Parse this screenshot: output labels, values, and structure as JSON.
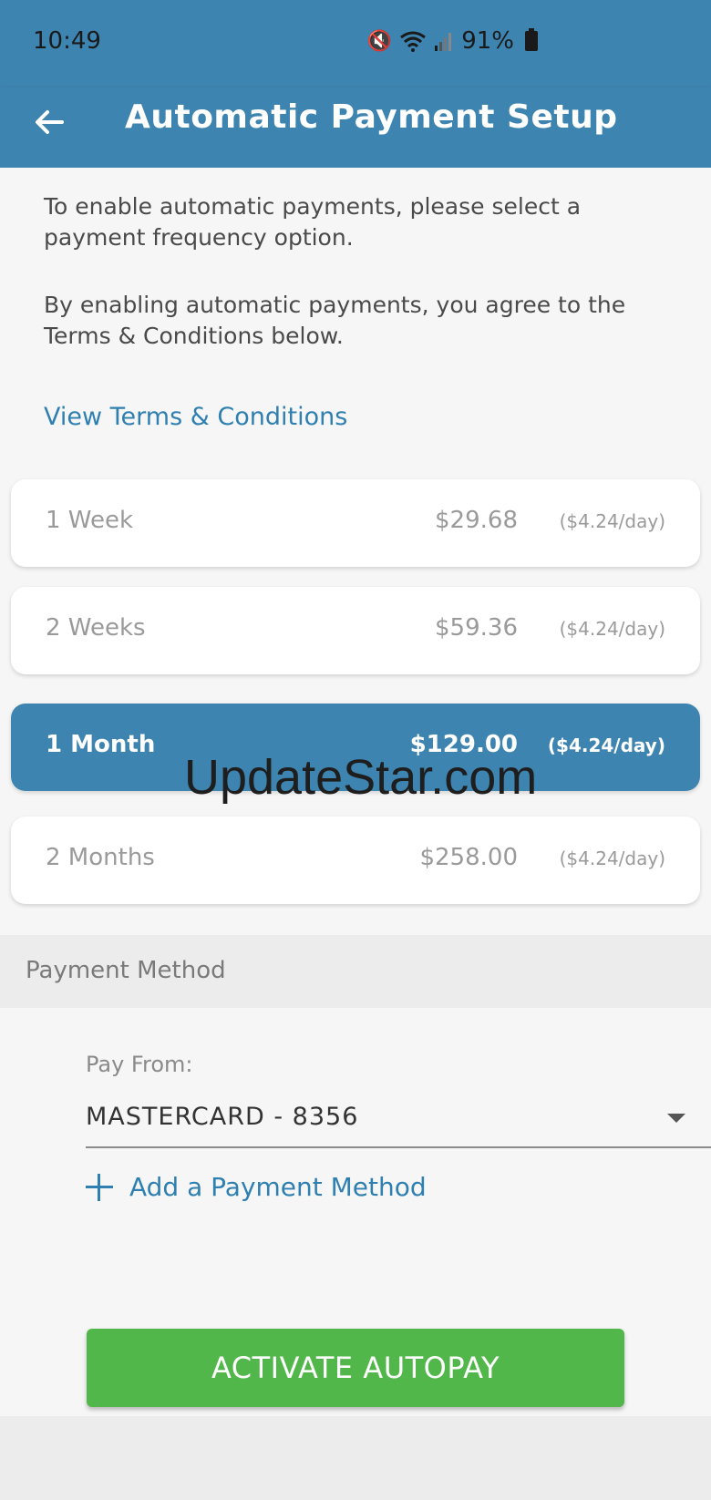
{
  "status": {
    "time": "10:49",
    "battery": "91%",
    "icons": [
      "mute-icon",
      "wifi-icon",
      "signal-icon",
      "battery-icon"
    ]
  },
  "appbar": {
    "title": "Automatic Payment Setup",
    "back_icon": "arrow-left-icon"
  },
  "intro": {
    "line1": "To enable automatic payments, please select a payment frequency option.",
    "line2": "By enabling automatic payments, you agree to the Terms & Conditions below.",
    "terms_link": "View Terms & Conditions"
  },
  "options": [
    {
      "label": "1 Week",
      "price": "$29.68",
      "per_day": "($4.24/day)",
      "selected": false
    },
    {
      "label": "2 Weeks",
      "price": "$59.36",
      "per_day": "($4.24/day)",
      "selected": false
    },
    {
      "label": "1 Month",
      "price": "$129.00",
      "per_day": "($4.24/day)",
      "selected": true
    },
    {
      "label": "2 Months",
      "price": "$258.00",
      "per_day": "($4.24/day)",
      "selected": false
    }
  ],
  "watermark": "UpdateStar.com",
  "payment_method": {
    "section_title": "Payment Method",
    "pay_from_label": "Pay From:",
    "selected_method": "MASTERCARD - 8356",
    "add_method_label": "Add a Payment Method"
  },
  "activate_button": "ACTIVATE AUTOPAY",
  "colors": {
    "primary": "#3e84b0",
    "link": "#2f80b0",
    "button_green": "#52b74a"
  }
}
